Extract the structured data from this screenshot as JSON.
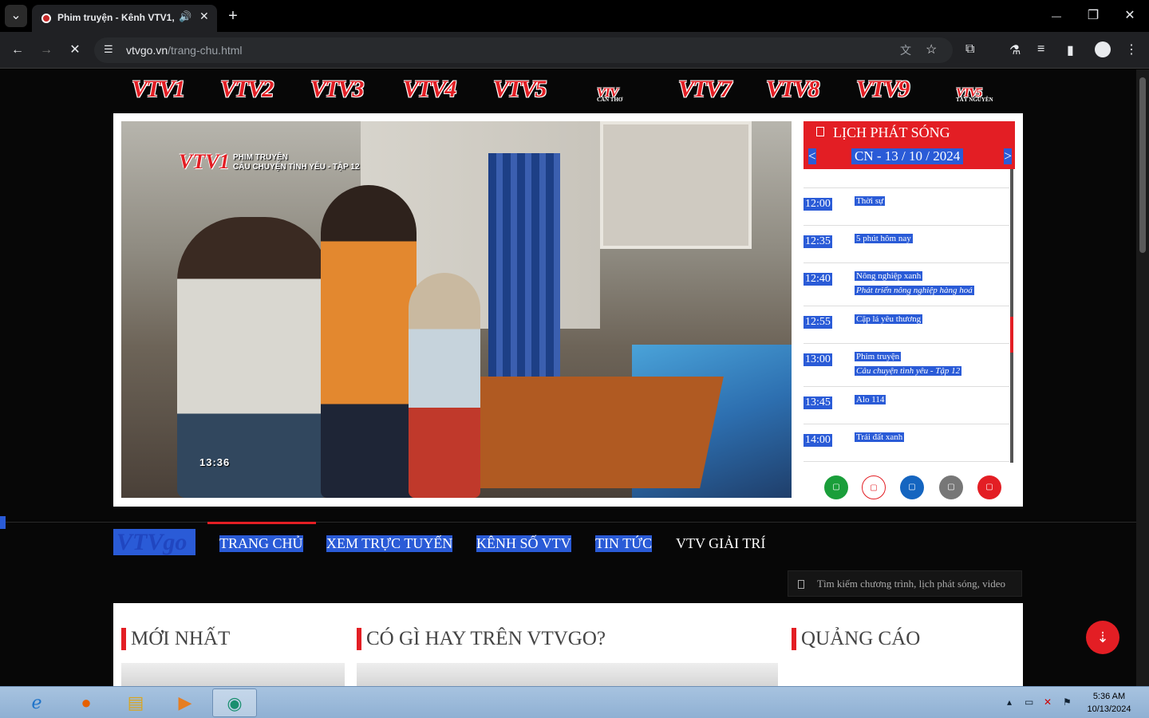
{
  "browser": {
    "tab_title": "Phim truyện - Kênh VTV1,",
    "url_host": "vtvgo.vn",
    "url_path": "/trang-chu.html",
    "new_tab": "+",
    "tab_close": "✕",
    "speaker": "🔊",
    "back": "←",
    "forward": "→",
    "stop": "✕",
    "menu": "⋮",
    "minimize": "—",
    "restore": "❐",
    "close": "✕",
    "tab_list": "⌄"
  },
  "channels": [
    {
      "name": "VTV1",
      "sub": ""
    },
    {
      "name": "VTV2",
      "sub": ""
    },
    {
      "name": "VTV3",
      "sub": ""
    },
    {
      "name": "VTV4",
      "sub": ""
    },
    {
      "name": "VTV5",
      "sub": ""
    },
    {
      "name": "VTV",
      "sub": "CẦN THƠ"
    },
    {
      "name": "VTV7",
      "sub": ""
    },
    {
      "name": "VTV8",
      "sub": ""
    },
    {
      "name": "VTV9",
      "sub": ""
    },
    {
      "name": "VTV5",
      "sub": "TÂY NGUYÊN"
    }
  ],
  "video": {
    "logo": "VTV1",
    "caption_line1": "PHIM TRUYỆN",
    "caption_line2": "CÂU CHUYỆN TÌNH YÊU - TẬP 12",
    "time": "13:36"
  },
  "schedule": {
    "title": "LỊCH PHÁT SÓNG",
    "date": "CN - 13 / 10 / 2024",
    "prev": "<",
    "next": ">",
    "rows": [
      {
        "time": "12:00",
        "name": "Thời sự",
        "desc": ""
      },
      {
        "time": "12:35",
        "name": "5 phút hôm nay",
        "desc": ""
      },
      {
        "time": "12:40",
        "name": "Nông nghiệp xanh",
        "desc": "Phát triển nông nghiệp hàng hoá"
      },
      {
        "time": "12:55",
        "name": "Cặp lá yêu thương",
        "desc": ""
      },
      {
        "time": "13:00",
        "name": "Phim truyện",
        "desc": "Câu chuyện tình yêu - Tập 12"
      },
      {
        "time": "13:45",
        "name": "Alo 114",
        "desc": ""
      },
      {
        "time": "14:00",
        "name": "Trái đất xanh",
        "desc": ""
      }
    ],
    "social_colors": [
      "#1a9e3a",
      "#ffffff",
      "#1565c0",
      "#777777",
      "#e31e24"
    ]
  },
  "nav": {
    "logo": "VTVgo",
    "items": [
      "TRANG CHỦ",
      "XEM TRỰC TUYẾN",
      "KÊNH SỐ VTV",
      "TIN TỨC",
      "VTV GIẢI TRÍ"
    ]
  },
  "search": {
    "placeholder": "Tìm kiếm chương trình, lịch phát sóng, video"
  },
  "sections": [
    "MỚI NHẤT",
    "CÓ GÌ HAY TRÊN VTVGO?",
    "QUẢNG CÁO"
  ],
  "taskbar": {
    "time": "5:36 AM",
    "date": "10/13/2024"
  },
  "colors": {
    "brand_red": "#e31e24",
    "brand_blue": "#2a5bd7"
  }
}
